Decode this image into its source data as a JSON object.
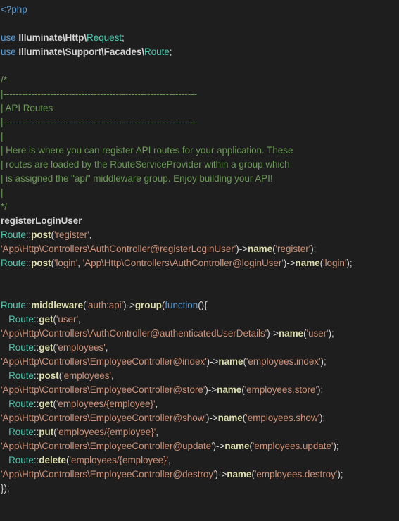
{
  "editor": {
    "language": "php",
    "theme": "dark-plus",
    "background_color": "#1e1e1e",
    "foreground_color": "#d4d4d4",
    "colors": {
      "keyword": "#569cd6",
      "class": "#4ec9b0",
      "comment": "#6a9955",
      "string": "#ce9178",
      "function": "#dcdcaa",
      "punctuation": "#d4d4d4"
    },
    "lines": [
      {
        "id": 1,
        "text": "<?php",
        "tokens": [
          {
            "t": "<?php",
            "c": "t-keyword"
          }
        ]
      },
      {
        "id": 2,
        "text": "",
        "tokens": []
      },
      {
        "id": 3,
        "text": "use Illuminate\\Http\\Request;",
        "tokens": [
          {
            "t": "use ",
            "c": "t-keyword"
          },
          {
            "t": "Illuminate\\Http\\",
            "c": "t-ns"
          },
          {
            "t": "Request",
            "c": "t-class"
          },
          {
            "t": ";",
            "c": "t-punct"
          }
        ]
      },
      {
        "id": 4,
        "text": "use Illuminate\\Support\\Facades\\Route;",
        "tokens": [
          {
            "t": "use ",
            "c": "t-keyword"
          },
          {
            "t": "Illuminate\\Support\\Facades\\",
            "c": "t-ns"
          },
          {
            "t": "Route",
            "c": "t-class"
          },
          {
            "t": ";",
            "c": "t-punct"
          }
        ]
      },
      {
        "id": 5,
        "text": "",
        "tokens": []
      },
      {
        "id": 6,
        "text": "/*",
        "tokens": [
          {
            "t": "/*",
            "c": "t-comment"
          }
        ]
      },
      {
        "id": 7,
        "text": "|--------------------------------------------------------------",
        "tokens": [
          {
            "t": "|--------------------------------------------------------------",
            "c": "t-comment"
          }
        ]
      },
      {
        "id": 8,
        "text": "| API Routes",
        "tokens": [
          {
            "t": "| API Routes",
            "c": "t-comment"
          }
        ]
      },
      {
        "id": 9,
        "text": "|--------------------------------------------------------------",
        "tokens": [
          {
            "t": "|--------------------------------------------------------------",
            "c": "t-comment"
          }
        ]
      },
      {
        "id": 10,
        "text": "|",
        "tokens": [
          {
            "t": "|",
            "c": "t-comment"
          }
        ]
      },
      {
        "id": 11,
        "text": "| Here is where you can register API routes for your application. These",
        "tokens": [
          {
            "t": "| Here is where you can register API routes for your application. These",
            "c": "t-comment"
          }
        ]
      },
      {
        "id": 12,
        "text": "| routes are loaded by the RouteServiceProvider within a group which",
        "tokens": [
          {
            "t": "| routes are loaded by the RouteServiceProvider within a group which",
            "c": "t-comment"
          }
        ]
      },
      {
        "id": 13,
        "text": "| is assigned the \"api\" middleware group. Enjoy building your API!",
        "tokens": [
          {
            "t": "| is assigned the \"api\" middleware group. Enjoy building your API!",
            "c": "t-comment"
          }
        ]
      },
      {
        "id": 14,
        "text": "|",
        "tokens": [
          {
            "t": "|",
            "c": "t-comment"
          }
        ]
      },
      {
        "id": 15,
        "text": "*/",
        "tokens": [
          {
            "t": "*/",
            "c": "t-comment"
          }
        ]
      },
      {
        "id": 16,
        "text": "registerLoginUser",
        "tokens": [
          {
            "t": "registerLoginUser",
            "c": "t-plain-bold"
          }
        ]
      },
      {
        "id": 17,
        "text": "Route::post('register',",
        "tokens": [
          {
            "t": "Route",
            "c": "t-class"
          },
          {
            "t": "::",
            "c": "t-punct"
          },
          {
            "t": "post",
            "c": "t-func"
          },
          {
            "t": "(",
            "c": "t-punct"
          },
          {
            "t": "'register'",
            "c": "t-string"
          },
          {
            "t": ",",
            "c": "t-punct"
          }
        ]
      },
      {
        "id": 18,
        "text": "'App\\Http\\Controllers\\AuthController@registerLoginUser')->name('register');",
        "tokens": [
          {
            "t": "'App\\Http\\Controllers\\AuthController@registerLoginUser'",
            "c": "t-string"
          },
          {
            "t": ")->",
            "c": "t-punct"
          },
          {
            "t": "name",
            "c": "t-func"
          },
          {
            "t": "(",
            "c": "t-punct"
          },
          {
            "t": "'register'",
            "c": "t-string"
          },
          {
            "t": ");",
            "c": "t-punct"
          }
        ]
      },
      {
        "id": 19,
        "text": "Route::post('login', 'App\\Http\\Controllers\\AuthController@loginUser')->name('login');",
        "tokens": [
          {
            "t": "Route",
            "c": "t-class"
          },
          {
            "t": "::",
            "c": "t-punct"
          },
          {
            "t": "post",
            "c": "t-func"
          },
          {
            "t": "(",
            "c": "t-punct"
          },
          {
            "t": "'login'",
            "c": "t-string"
          },
          {
            "t": ", ",
            "c": "t-punct"
          },
          {
            "t": "'App\\Http\\Controllers\\AuthController@loginUser'",
            "c": "t-string"
          },
          {
            "t": ")->",
            "c": "t-punct"
          },
          {
            "t": "name",
            "c": "t-func"
          },
          {
            "t": "(",
            "c": "t-punct"
          },
          {
            "t": "'login'",
            "c": "t-string"
          },
          {
            "t": ");",
            "c": "t-punct"
          }
        ]
      },
      {
        "id": 20,
        "text": "",
        "tokens": []
      },
      {
        "id": 21,
        "text": "",
        "tokens": []
      },
      {
        "id": 22,
        "text": "Route::middleware('auth:api')->group(function(){",
        "tokens": [
          {
            "t": "Route",
            "c": "t-class"
          },
          {
            "t": "::",
            "c": "t-punct"
          },
          {
            "t": "middleware",
            "c": "t-func"
          },
          {
            "t": "(",
            "c": "t-punct"
          },
          {
            "t": "'auth:api'",
            "c": "t-string"
          },
          {
            "t": ")->",
            "c": "t-punct"
          },
          {
            "t": "group",
            "c": "t-func"
          },
          {
            "t": "(",
            "c": "t-punct"
          },
          {
            "t": "function",
            "c": "t-keyword"
          },
          {
            "t": "(){",
            "c": "t-punct"
          }
        ]
      },
      {
        "id": 23,
        "text": "   Route::get('user',",
        "tokens": [
          {
            "t": "   ",
            "c": "t-punct"
          },
          {
            "t": "Route",
            "c": "t-class"
          },
          {
            "t": "::",
            "c": "t-punct"
          },
          {
            "t": "get",
            "c": "t-func"
          },
          {
            "t": "(",
            "c": "t-punct"
          },
          {
            "t": "'user'",
            "c": "t-string"
          },
          {
            "t": ",",
            "c": "t-punct"
          }
        ]
      },
      {
        "id": 24,
        "text": "'App\\Http\\Controllers\\AuthController@authenticatedUserDetails')->name('user');",
        "tokens": [
          {
            "t": "'App\\Http\\Controllers\\AuthController@authenticatedUserDetails'",
            "c": "t-string"
          },
          {
            "t": ")->",
            "c": "t-punct"
          },
          {
            "t": "name",
            "c": "t-func"
          },
          {
            "t": "(",
            "c": "t-punct"
          },
          {
            "t": "'user'",
            "c": "t-string"
          },
          {
            "t": ");",
            "c": "t-punct"
          }
        ]
      },
      {
        "id": 25,
        "text": "   Route::get('employees',",
        "tokens": [
          {
            "t": "   ",
            "c": "t-punct"
          },
          {
            "t": "Route",
            "c": "t-class"
          },
          {
            "t": "::",
            "c": "t-punct"
          },
          {
            "t": "get",
            "c": "t-func"
          },
          {
            "t": "(",
            "c": "t-punct"
          },
          {
            "t": "'employees'",
            "c": "t-string"
          },
          {
            "t": ",",
            "c": "t-punct"
          }
        ]
      },
      {
        "id": 26,
        "text": "'App\\Http\\Controllers\\EmployeeController@index')->name('employees.index');",
        "tokens": [
          {
            "t": "'App\\Http\\Controllers\\EmployeeController@index'",
            "c": "t-string"
          },
          {
            "t": ")->",
            "c": "t-punct"
          },
          {
            "t": "name",
            "c": "t-func"
          },
          {
            "t": "(",
            "c": "t-punct"
          },
          {
            "t": "'employees.index'",
            "c": "t-string"
          },
          {
            "t": ");",
            "c": "t-punct"
          }
        ]
      },
      {
        "id": 27,
        "text": "   Route::post('employees',",
        "tokens": [
          {
            "t": "   ",
            "c": "t-punct"
          },
          {
            "t": "Route",
            "c": "t-class"
          },
          {
            "t": "::",
            "c": "t-punct"
          },
          {
            "t": "post",
            "c": "t-func"
          },
          {
            "t": "(",
            "c": "t-punct"
          },
          {
            "t": "'employees'",
            "c": "t-string"
          },
          {
            "t": ",",
            "c": "t-punct"
          }
        ]
      },
      {
        "id": 28,
        "text": "'App\\Http\\Controllers\\EmployeeController@store')->name('employees.store');",
        "tokens": [
          {
            "t": "'App\\Http\\Controllers\\EmployeeController@store'",
            "c": "t-string"
          },
          {
            "t": ")->",
            "c": "t-punct"
          },
          {
            "t": "name",
            "c": "t-func"
          },
          {
            "t": "(",
            "c": "t-punct"
          },
          {
            "t": "'employees.store'",
            "c": "t-string"
          },
          {
            "t": ");",
            "c": "t-punct"
          }
        ]
      },
      {
        "id": 29,
        "text": "   Route::get('employees/{employee}',",
        "tokens": [
          {
            "t": "   ",
            "c": "t-punct"
          },
          {
            "t": "Route",
            "c": "t-class"
          },
          {
            "t": "::",
            "c": "t-punct"
          },
          {
            "t": "get",
            "c": "t-func"
          },
          {
            "t": "(",
            "c": "t-punct"
          },
          {
            "t": "'employees/{employee}'",
            "c": "t-string"
          },
          {
            "t": ",",
            "c": "t-punct"
          }
        ]
      },
      {
        "id": 30,
        "text": "'App\\Http\\Controllers\\EmployeeController@show')->name('employees.show');",
        "tokens": [
          {
            "t": "'App\\Http\\Controllers\\EmployeeController@show'",
            "c": "t-string"
          },
          {
            "t": ")->",
            "c": "t-punct"
          },
          {
            "t": "name",
            "c": "t-func"
          },
          {
            "t": "(",
            "c": "t-punct"
          },
          {
            "t": "'employees.show'",
            "c": "t-string"
          },
          {
            "t": ");",
            "c": "t-punct"
          }
        ]
      },
      {
        "id": 31,
        "text": "   Route::put('employees/{employee}',",
        "tokens": [
          {
            "t": "   ",
            "c": "t-punct"
          },
          {
            "t": "Route",
            "c": "t-class"
          },
          {
            "t": "::",
            "c": "t-punct"
          },
          {
            "t": "put",
            "c": "t-func"
          },
          {
            "t": "(",
            "c": "t-punct"
          },
          {
            "t": "'employees/{employee}'",
            "c": "t-string"
          },
          {
            "t": ",",
            "c": "t-punct"
          }
        ]
      },
      {
        "id": 32,
        "text": "'App\\Http\\Controllers\\EmployeeController@update')->name('employees.update');",
        "tokens": [
          {
            "t": "'App\\Http\\Controllers\\EmployeeController@update'",
            "c": "t-string"
          },
          {
            "t": ")->",
            "c": "t-punct"
          },
          {
            "t": "name",
            "c": "t-func"
          },
          {
            "t": "(",
            "c": "t-punct"
          },
          {
            "t": "'employees.update'",
            "c": "t-string"
          },
          {
            "t": ");",
            "c": "t-punct"
          }
        ]
      },
      {
        "id": 33,
        "text": "   Route::delete('employees/{employee}',",
        "tokens": [
          {
            "t": "   ",
            "c": "t-punct"
          },
          {
            "t": "Route",
            "c": "t-class"
          },
          {
            "t": "::",
            "c": "t-punct"
          },
          {
            "t": "delete",
            "c": "t-func"
          },
          {
            "t": "(",
            "c": "t-punct"
          },
          {
            "t": "'employees/{employee}'",
            "c": "t-string"
          },
          {
            "t": ",",
            "c": "t-punct"
          }
        ]
      },
      {
        "id": 34,
        "text": "'App\\Http\\Controllers\\EmployeeController@destroy')->name('employees.destroy');",
        "tokens": [
          {
            "t": "'App\\Http\\Controllers\\EmployeeController@destroy'",
            "c": "t-string"
          },
          {
            "t": ")->",
            "c": "t-punct"
          },
          {
            "t": "name",
            "c": "t-func"
          },
          {
            "t": "(",
            "c": "t-punct"
          },
          {
            "t": "'employees.destroy'",
            "c": "t-string"
          },
          {
            "t": ");",
            "c": "t-punct"
          }
        ]
      },
      {
        "id": 35,
        "text": "});",
        "tokens": [
          {
            "t": "});",
            "c": "t-punct"
          }
        ]
      }
    ]
  }
}
